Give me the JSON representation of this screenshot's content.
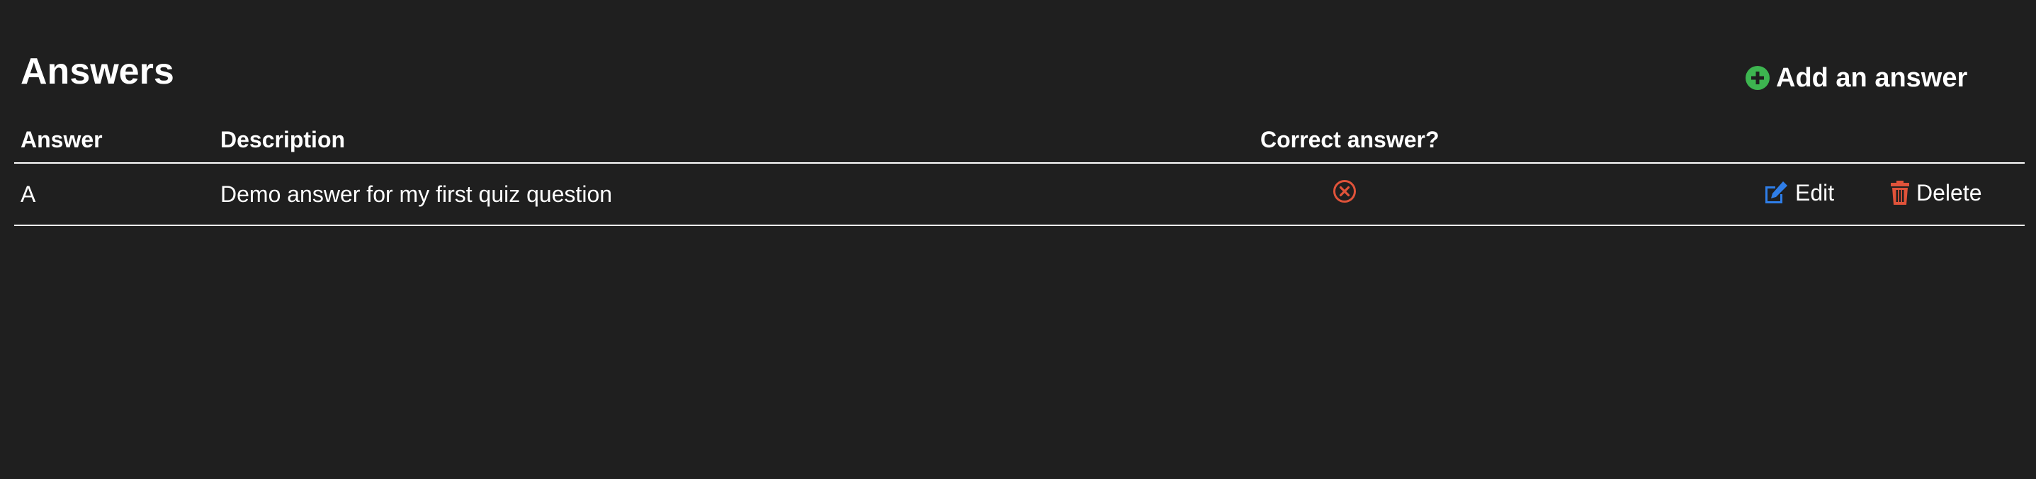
{
  "page": {
    "title": "Answers"
  },
  "add_button": {
    "label": "Add an answer",
    "icon": "plus-circle-icon",
    "icon_color": "#3db550"
  },
  "table": {
    "headers": {
      "answer": "Answer",
      "description": "Description",
      "correct": "Correct answer?"
    },
    "rows": [
      {
        "answer": "A",
        "description": "Demo answer for my first quiz question",
        "correct": false,
        "correct_icon": "x-circle-icon",
        "edit_label": "Edit",
        "delete_label": "Delete"
      }
    ]
  },
  "colors": {
    "background": "#1f1f1f",
    "text": "#ffffff",
    "edit_icon": "#2f7ee8",
    "incorrect_icon": "#e0533a",
    "delete_icon": "#e0533a"
  }
}
